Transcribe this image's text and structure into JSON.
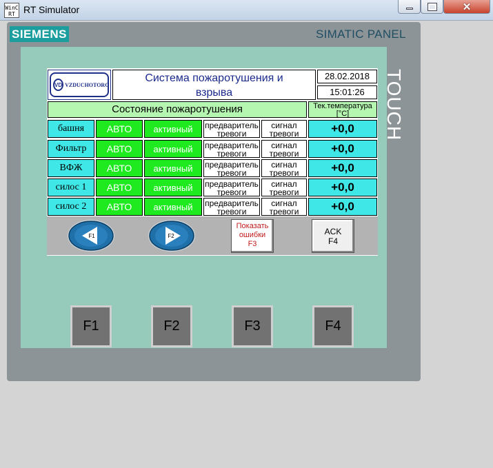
{
  "window": {
    "title": "RT Simulator",
    "icon_text_top": "WinC",
    "icon_text_bottom": "RT",
    "minimize_icon": "minimize-icon",
    "maximize_icon": "maximize-icon",
    "close_icon": "close-icon",
    "close_glyph": "✕"
  },
  "panel": {
    "brand": "SIEMENS",
    "model": "SIMATIC PANEL",
    "touch": "TOUCH"
  },
  "header": {
    "logo_mark": "VD",
    "logo_text": "VZDUCHOTORG",
    "title_line1": "Система пожаротушения и",
    "title_line2": "взрыва",
    "date": "28.02.2018",
    "time": "15:01:26"
  },
  "table": {
    "status_heading": "Состояние пожаротушения",
    "temp_heading_line1": "Тек.температура",
    "temp_heading_line2": "[°C]",
    "rows": [
      {
        "name": "башня",
        "mode": "АВТО",
        "state": "активный",
        "pre_line1": "предваритель",
        "pre_line2": "тревоги",
        "sig_line1": "сигнал",
        "sig_line2": "тревоги",
        "temp": "+0,0"
      },
      {
        "name": "Фильтр",
        "mode": "АВТО",
        "state": "активный",
        "pre_line1": "предваритель",
        "pre_line2": "тревоги",
        "sig_line1": "сигнал",
        "sig_line2": "тревоги",
        "temp": "+0,0"
      },
      {
        "name": "ВФЖ",
        "mode": "АВТО",
        "state": "активный",
        "pre_line1": "предваритель",
        "pre_line2": "тревоги",
        "sig_line1": "сигнал",
        "sig_line2": "тревоги",
        "temp": "+0,0"
      },
      {
        "name": "силос 1",
        "mode": "АВТО",
        "state": "активный",
        "pre_line1": "предваритель",
        "pre_line2": "тревоги",
        "sig_line1": "сигнал",
        "sig_line2": "тревоги",
        "temp": "+0,0"
      },
      {
        "name": "силос 2",
        "mode": "АВТО",
        "state": "активный",
        "pre_line1": "предваритель",
        "pre_line2": "тревоги",
        "sig_line1": "сигнал",
        "sig_line2": "тревоги",
        "temp": "+0,0"
      }
    ]
  },
  "toolbar": {
    "prev_label": "F1",
    "next_label": "F2",
    "errors_line1": "Показать",
    "errors_line2": "ошибки",
    "errors_line3": "F3",
    "ack_line1": "ACK",
    "ack_line2": "F4"
  },
  "function_keys": [
    "F1",
    "F2",
    "F3",
    "F4"
  ],
  "colors": {
    "bezel": "#96cbbc",
    "header_green": "#b5f7b0",
    "cyan": "#3fe7e7",
    "green": "#1fea1f",
    "brand": "#1d9e9e"
  }
}
